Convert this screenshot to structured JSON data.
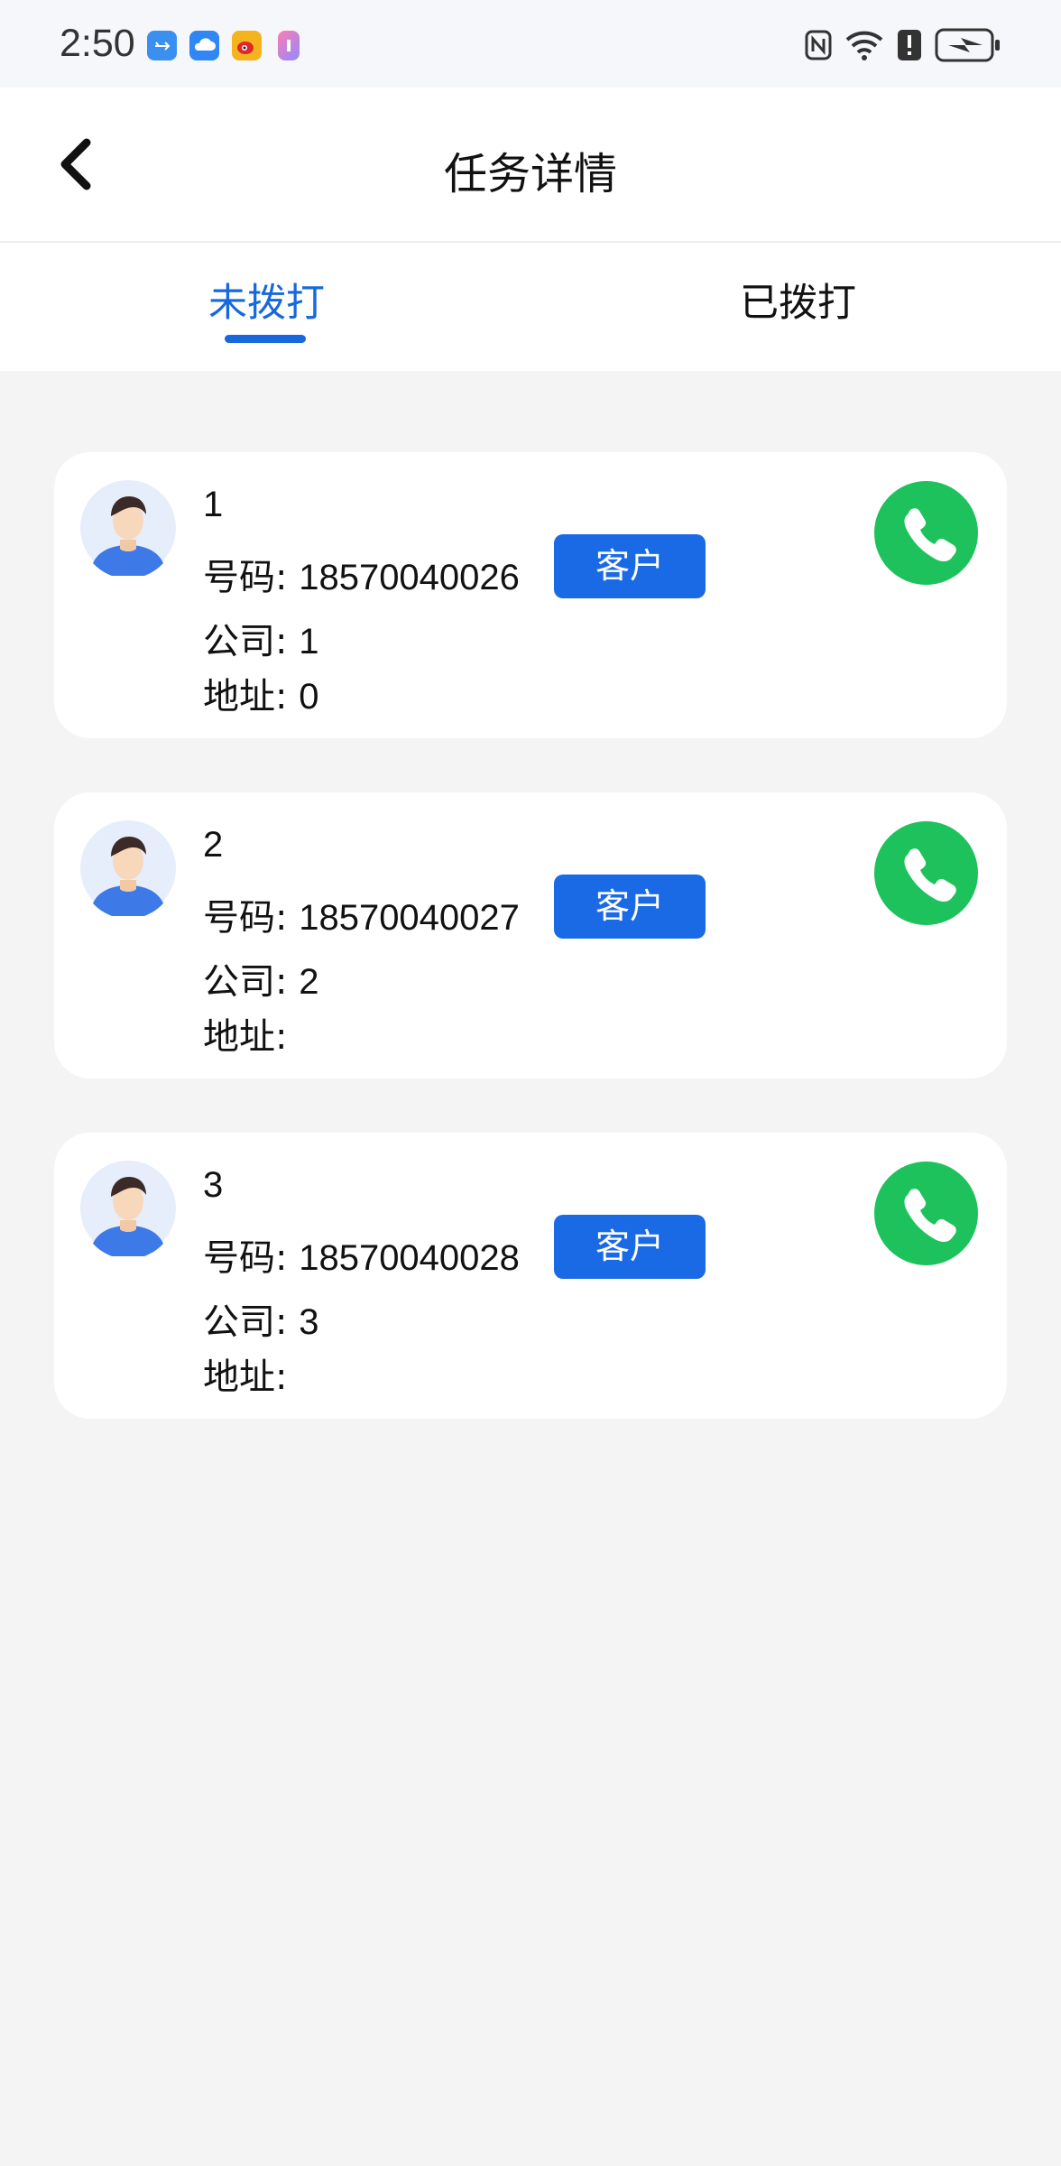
{
  "status_bar": {
    "time": "2:50",
    "app_icons": [
      "usb-icon",
      "cloud-icon",
      "weibo-icon",
      "app-icon"
    ],
    "right_icons": [
      "nfc-icon",
      "wifi-icon",
      "alert-icon",
      "battery-charging-icon"
    ]
  },
  "header": {
    "title": "任务详情",
    "back_icon": "back-chevron-icon"
  },
  "tabs": [
    {
      "label": "未拨打",
      "active": true
    },
    {
      "label": "已拨打",
      "active": false
    }
  ],
  "labels": {
    "phone": "号码:",
    "company": "公司:",
    "address": "地址:"
  },
  "contacts": [
    {
      "name": "1",
      "phone": "18570040026",
      "tag": "客户",
      "company": "1",
      "address": "0"
    },
    {
      "name": "2",
      "phone": "18570040027",
      "tag": "客户",
      "company": "2",
      "address": ""
    },
    {
      "name": "3",
      "phone": "18570040028",
      "tag": "客户",
      "company": "3",
      "address": ""
    }
  ],
  "colors": {
    "accent": "#1668dc",
    "tag_bg": "#1a6ae6",
    "call_green": "#1ec25c",
    "page_bg": "#f4f4f5"
  }
}
